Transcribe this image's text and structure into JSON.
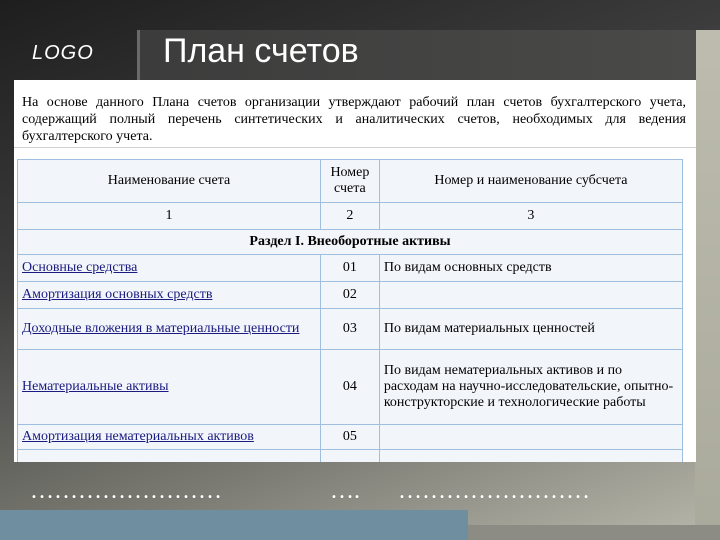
{
  "logo": "LOGO",
  "title": "План счетов",
  "intro": "На основе данного Плана счетов организации утверждают рабочий план счетов бухгалтерского учета, содержащий полный перечень синтетических и аналитических счетов, необходимых для ведения бухгалтерского учета.",
  "table": {
    "headers": [
      "Наименование счета",
      "Номер счета",
      "Номер и наименование субсчета"
    ],
    "numbers": [
      "1",
      "2",
      "3"
    ],
    "section": "Раздел I. Внеоборотные активы",
    "rows": [
      {
        "name": "Основные средства",
        "code": "01",
        "sub": "По видам основных средств"
      },
      {
        "name": "Амортизация основных средств",
        "code": "02",
        "sub": ""
      },
      {
        "name": "Доходные вложения в материальные ценности",
        "code": "03",
        "sub": "По видам материальных ценностей"
      },
      {
        "name": "Нематериальные активы",
        "code": "04",
        "sub": "По видам нематериальных активов и по расходам на научно-исследовательские, опытно-конструкторские и технологические работы"
      },
      {
        "name": "Амортизация нематериальных активов",
        "code": "05",
        "sub": ""
      },
      {
        "name": "",
        "code": "…",
        "sub": ""
      }
    ]
  },
  "footer": {
    "dots_left": "……………………",
    "dots_mid": "….",
    "dots_right": "……………………"
  },
  "colors": {
    "table_border": "#9fbfe0",
    "link": "#1a1a80",
    "accent": "#6f8fa0"
  }
}
